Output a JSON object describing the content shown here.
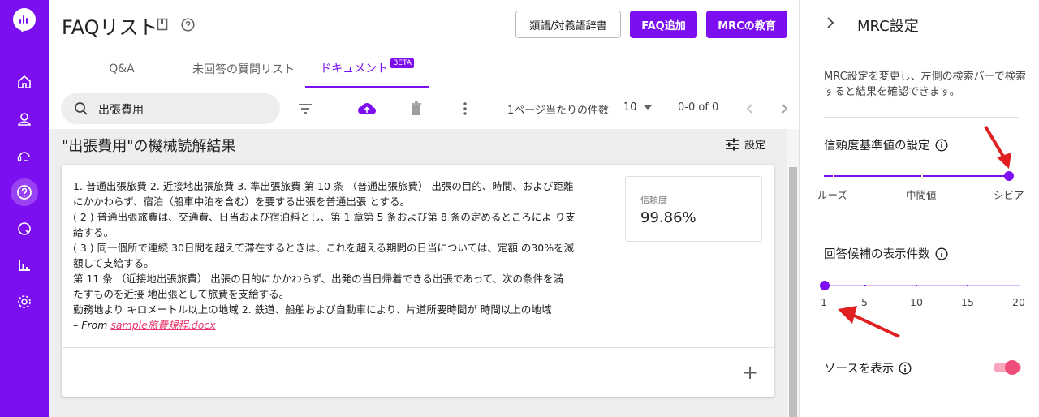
{
  "header": {
    "title": "FAQリスト",
    "buttons": {
      "dictionary": "類語/対義語辞書",
      "add_faq": "FAQ追加",
      "mrc_training": "MRCの教育"
    }
  },
  "tabs": [
    {
      "label": "Q&A"
    },
    {
      "label": "未回答の質問リスト"
    },
    {
      "label": "ドキュメント",
      "badge": "BETA",
      "active": true
    }
  ],
  "toolbar": {
    "search_value": "出張費用",
    "per_page_label": "1ページ当たりの件数",
    "per_page_value": "10",
    "range": "0-0 of 0"
  },
  "result": {
    "title": "\"出張費用\"の機械読解結果",
    "settings_label": "設定",
    "lines": [
      "1. 普通出張旅費 2. 近接地出張旅費 3. 準出張旅費 第 10 条 （普通出張旅費） 出張の目的、時間、および距離",
      "にかかわらず、宿泊（船車中泊を含む）を要する出張を普通出張 とする。",
      "( 2 ) 普通出張旅費は、交通費、日当および宿泊料とし、第 1 章第 5 条および第 8 条の定めるところによ り支",
      "給する。",
      "( 3 ) 同一個所で連続 30日間を超えて滞在するときは、これを超える期間の日当については、定額 の30%を減",
      "額して支給する。",
      "第 11 条 （近接地出張旅費） 出張の目的にかかわらず、出発の当日帰着できる出張であって、次の条件を満",
      "たすものを近接 地出張として旅費を支給する。",
      "勤務地より キロメートル以上の地域 2. 鉄道、船舶および自動車により、片道所要時間が 時間以上の地域"
    ],
    "source_prefix": "– From ",
    "source_file": "sample旅費規程.docx",
    "confidence_label": "信頼度",
    "confidence_value": "99.86%"
  },
  "panel": {
    "title": "MRC設定",
    "description": "MRC設定を変更し、左側の検索バーで検索すると結果を確認できます。",
    "threshold": {
      "label": "信頼度基準値の設定",
      "ticks": [
        "ルーズ",
        "中間値",
        "シビア"
      ],
      "selected": "シビア"
    },
    "candidates": {
      "label": "回答候補の表示件数",
      "ticks": [
        "1",
        "5",
        "10",
        "15",
        "20"
      ],
      "value": 1
    },
    "show_source": {
      "label": "ソースを表示",
      "on": true
    }
  },
  "colors": {
    "accent": "#7b0ff0",
    "toggle": "#ee4d7a",
    "arrow": "#e02020",
    "link": "#e8366a"
  }
}
